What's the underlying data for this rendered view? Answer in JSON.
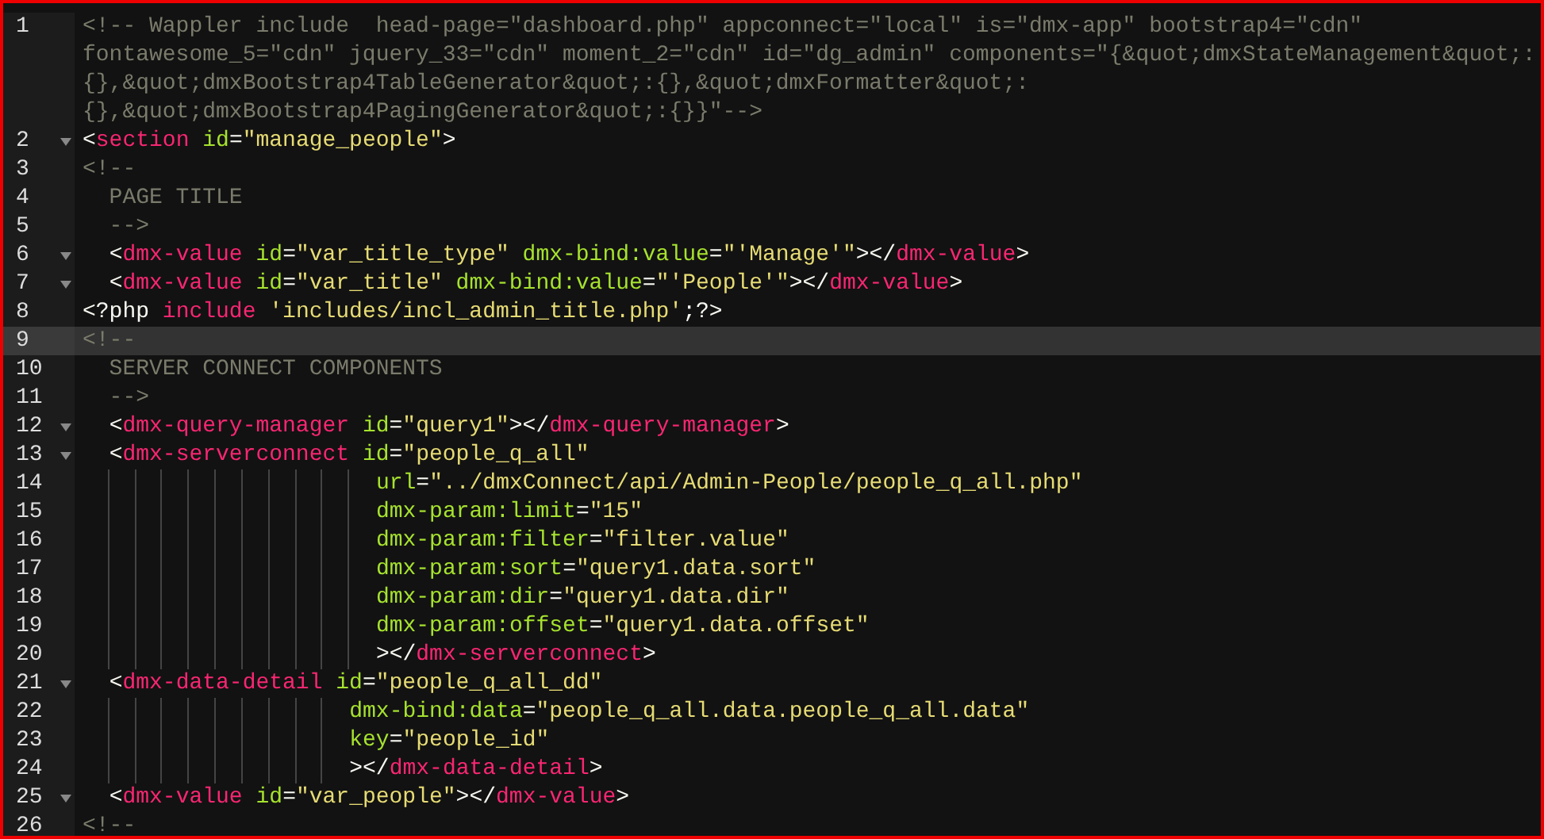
{
  "editor": {
    "lines": [
      {
        "number": "1",
        "fold": false,
        "current": false,
        "rows": [
          [
            {
              "kind": "comment",
              "text": "<!-- Wappler include  head-page=\"dashboard.php\" appconnect=\"local\" is=\"dmx-app\" bootstrap4=\"cdn\""
            }
          ],
          [
            {
              "kind": "comment",
              "text": "fontawesome_5=\"cdn\" jquery_33=\"cdn\" moment_2=\"cdn\" id=\"dg_admin\" components=\"{&quot;dmxStateManagement&quot;:"
            }
          ],
          [
            {
              "kind": "comment",
              "text": "{},&quot;dmxBootstrap4TableGenerator&quot;:{},&quot;dmxFormatter&quot;:"
            }
          ],
          [
            {
              "kind": "comment",
              "text": "{},&quot;dmxBootstrap4PagingGenerator&quot;:{}}\"-->"
            }
          ]
        ]
      },
      {
        "number": "2",
        "fold": true,
        "current": false,
        "rows": [
          [
            {
              "kind": "punct",
              "text": "<"
            },
            {
              "kind": "tag",
              "text": "section"
            },
            {
              "kind": "punct",
              "text": " "
            },
            {
              "kind": "attr",
              "text": "id"
            },
            {
              "kind": "punct",
              "text": "="
            },
            {
              "kind": "string",
              "text": "\"manage_people\""
            },
            {
              "kind": "punct",
              "text": ">"
            }
          ]
        ]
      },
      {
        "number": "3",
        "fold": false,
        "current": false,
        "rows": [
          [
            {
              "kind": "comment",
              "text": "<!--"
            }
          ]
        ]
      },
      {
        "number": "4",
        "fold": false,
        "current": false,
        "rows": [
          [
            {
              "kind": "comment",
              "text": "  PAGE TITLE"
            }
          ]
        ]
      },
      {
        "number": "5",
        "fold": false,
        "current": false,
        "rows": [
          [
            {
              "kind": "comment",
              "text": "  -->"
            }
          ]
        ]
      },
      {
        "number": "6",
        "fold": true,
        "current": false,
        "rows": [
          [
            {
              "kind": "indent",
              "text": "  "
            },
            {
              "kind": "punct",
              "text": "<"
            },
            {
              "kind": "tag",
              "text": "dmx-value"
            },
            {
              "kind": "punct",
              "text": " "
            },
            {
              "kind": "attr",
              "text": "id"
            },
            {
              "kind": "punct",
              "text": "="
            },
            {
              "kind": "string",
              "text": "\"var_title_type\""
            },
            {
              "kind": "punct",
              "text": " "
            },
            {
              "kind": "attr",
              "text": "dmx-bind:value"
            },
            {
              "kind": "punct",
              "text": "="
            },
            {
              "kind": "string",
              "text": "\"'Manage'\""
            },
            {
              "kind": "punct",
              "text": "></"
            },
            {
              "kind": "tag",
              "text": "dmx-value"
            },
            {
              "kind": "punct",
              "text": ">"
            }
          ]
        ]
      },
      {
        "number": "7",
        "fold": true,
        "current": false,
        "rows": [
          [
            {
              "kind": "indent",
              "text": "  "
            },
            {
              "kind": "punct",
              "text": "<"
            },
            {
              "kind": "tag",
              "text": "dmx-value"
            },
            {
              "kind": "punct",
              "text": " "
            },
            {
              "kind": "attr",
              "text": "id"
            },
            {
              "kind": "punct",
              "text": "="
            },
            {
              "kind": "string",
              "text": "\"var_title\""
            },
            {
              "kind": "punct",
              "text": " "
            },
            {
              "kind": "attr",
              "text": "dmx-bind:value"
            },
            {
              "kind": "punct",
              "text": "="
            },
            {
              "kind": "string",
              "text": "\"'People'\""
            },
            {
              "kind": "punct",
              "text": "></"
            },
            {
              "kind": "tag",
              "text": "dmx-value"
            },
            {
              "kind": "punct",
              "text": ">"
            }
          ]
        ]
      },
      {
        "number": "8",
        "fold": false,
        "current": false,
        "rows": [
          [
            {
              "kind": "punct",
              "text": "<?php "
            },
            {
              "kind": "tag",
              "text": "include"
            },
            {
              "kind": "punct",
              "text": " "
            },
            {
              "kind": "string",
              "text": "'includes/incl_admin_title.php'"
            },
            {
              "kind": "punct",
              "text": ";?>"
            }
          ]
        ]
      },
      {
        "number": "9",
        "fold": false,
        "current": true,
        "rows": [
          [
            {
              "kind": "comment",
              "text": "<!--"
            }
          ]
        ]
      },
      {
        "number": "10",
        "fold": false,
        "current": false,
        "rows": [
          [
            {
              "kind": "comment",
              "text": "  SERVER CONNECT COMPONENTS"
            }
          ]
        ]
      },
      {
        "number": "11",
        "fold": false,
        "current": false,
        "rows": [
          [
            {
              "kind": "comment",
              "text": "  -->"
            }
          ]
        ]
      },
      {
        "number": "12",
        "fold": true,
        "current": false,
        "rows": [
          [
            {
              "kind": "indent",
              "text": "  "
            },
            {
              "kind": "punct",
              "text": "<"
            },
            {
              "kind": "tag",
              "text": "dmx-query-manager"
            },
            {
              "kind": "punct",
              "text": " "
            },
            {
              "kind": "attr",
              "text": "id"
            },
            {
              "kind": "punct",
              "text": "="
            },
            {
              "kind": "string",
              "text": "\"query1\""
            },
            {
              "kind": "punct",
              "text": "></"
            },
            {
              "kind": "tag",
              "text": "dmx-query-manager"
            },
            {
              "kind": "punct",
              "text": ">"
            }
          ]
        ]
      },
      {
        "number": "13",
        "fold": true,
        "current": false,
        "rows": [
          [
            {
              "kind": "indent",
              "text": "  "
            },
            {
              "kind": "punct",
              "text": "<"
            },
            {
              "kind": "tag",
              "text": "dmx-serverconnect"
            },
            {
              "kind": "punct",
              "text": " "
            },
            {
              "kind": "attr",
              "text": "id"
            },
            {
              "kind": "punct",
              "text": "="
            },
            {
              "kind": "string",
              "text": "\"people_q_all\""
            }
          ]
        ]
      },
      {
        "number": "14",
        "fold": false,
        "current": false,
        "rows": [
          [
            {
              "kind": "indent",
              "text": "                      "
            },
            {
              "kind": "attr",
              "text": "url"
            },
            {
              "kind": "punct",
              "text": "="
            },
            {
              "kind": "string",
              "text": "\"../dmxConnect/api/Admin-People/people_q_all.php\""
            }
          ]
        ]
      },
      {
        "number": "15",
        "fold": false,
        "current": false,
        "rows": [
          [
            {
              "kind": "indent",
              "text": "                      "
            },
            {
              "kind": "attr",
              "text": "dmx-param:limit"
            },
            {
              "kind": "punct",
              "text": "="
            },
            {
              "kind": "string",
              "text": "\"15\""
            }
          ]
        ]
      },
      {
        "number": "16",
        "fold": false,
        "current": false,
        "rows": [
          [
            {
              "kind": "indent",
              "text": "                      "
            },
            {
              "kind": "attr",
              "text": "dmx-param:filter"
            },
            {
              "kind": "punct",
              "text": "="
            },
            {
              "kind": "string",
              "text": "\"filter.value\""
            }
          ]
        ]
      },
      {
        "number": "17",
        "fold": false,
        "current": false,
        "rows": [
          [
            {
              "kind": "indent",
              "text": "                      "
            },
            {
              "kind": "attr",
              "text": "dmx-param:sort"
            },
            {
              "kind": "punct",
              "text": "="
            },
            {
              "kind": "string",
              "text": "\"query1.data.sort\""
            }
          ]
        ]
      },
      {
        "number": "18",
        "fold": false,
        "current": false,
        "rows": [
          [
            {
              "kind": "indent",
              "text": "                      "
            },
            {
              "kind": "attr",
              "text": "dmx-param:dir"
            },
            {
              "kind": "punct",
              "text": "="
            },
            {
              "kind": "string",
              "text": "\"query1.data.dir\""
            }
          ]
        ]
      },
      {
        "number": "19",
        "fold": false,
        "current": false,
        "rows": [
          [
            {
              "kind": "indent",
              "text": "                      "
            },
            {
              "kind": "attr",
              "text": "dmx-param:offset"
            },
            {
              "kind": "punct",
              "text": "="
            },
            {
              "kind": "string",
              "text": "\"query1.data.offset\""
            }
          ]
        ]
      },
      {
        "number": "20",
        "fold": false,
        "current": false,
        "rows": [
          [
            {
              "kind": "indent",
              "text": "                      "
            },
            {
              "kind": "punct",
              "text": "></"
            },
            {
              "kind": "tag",
              "text": "dmx-serverconnect"
            },
            {
              "kind": "punct",
              "text": ">"
            }
          ]
        ]
      },
      {
        "number": "21",
        "fold": true,
        "current": false,
        "rows": [
          [
            {
              "kind": "indent",
              "text": "  "
            },
            {
              "kind": "punct",
              "text": "<"
            },
            {
              "kind": "tag",
              "text": "dmx-data-detail"
            },
            {
              "kind": "punct",
              "text": " "
            },
            {
              "kind": "attr",
              "text": "id"
            },
            {
              "kind": "punct",
              "text": "="
            },
            {
              "kind": "string",
              "text": "\"people_q_all_dd\""
            }
          ]
        ]
      },
      {
        "number": "22",
        "fold": false,
        "current": false,
        "rows": [
          [
            {
              "kind": "indent",
              "text": "                    "
            },
            {
              "kind": "attr",
              "text": "dmx-bind:data"
            },
            {
              "kind": "punct",
              "text": "="
            },
            {
              "kind": "string",
              "text": "\"people_q_all.data.people_q_all.data\""
            }
          ]
        ]
      },
      {
        "number": "23",
        "fold": false,
        "current": false,
        "rows": [
          [
            {
              "kind": "indent",
              "text": "                    "
            },
            {
              "kind": "attr",
              "text": "key"
            },
            {
              "kind": "punct",
              "text": "="
            },
            {
              "kind": "string",
              "text": "\"people_id\""
            }
          ]
        ]
      },
      {
        "number": "24",
        "fold": false,
        "current": false,
        "rows": [
          [
            {
              "kind": "indent",
              "text": "                    "
            },
            {
              "kind": "punct",
              "text": "></"
            },
            {
              "kind": "tag",
              "text": "dmx-data-detail"
            },
            {
              "kind": "punct",
              "text": ">"
            }
          ]
        ]
      },
      {
        "number": "25",
        "fold": true,
        "current": false,
        "rows": [
          [
            {
              "kind": "indent",
              "text": "  "
            },
            {
              "kind": "punct",
              "text": "<"
            },
            {
              "kind": "tag",
              "text": "dmx-value"
            },
            {
              "kind": "punct",
              "text": " "
            },
            {
              "kind": "attr",
              "text": "id"
            },
            {
              "kind": "punct",
              "text": "="
            },
            {
              "kind": "string",
              "text": "\"var_people\""
            },
            {
              "kind": "punct",
              "text": "></"
            },
            {
              "kind": "tag",
              "text": "dmx-value"
            },
            {
              "kind": "punct",
              "text": ">"
            }
          ]
        ]
      },
      {
        "number": "26",
        "fold": false,
        "current": false,
        "rows": [
          [
            {
              "kind": "comment",
              "text": "<!--"
            }
          ]
        ]
      }
    ]
  }
}
